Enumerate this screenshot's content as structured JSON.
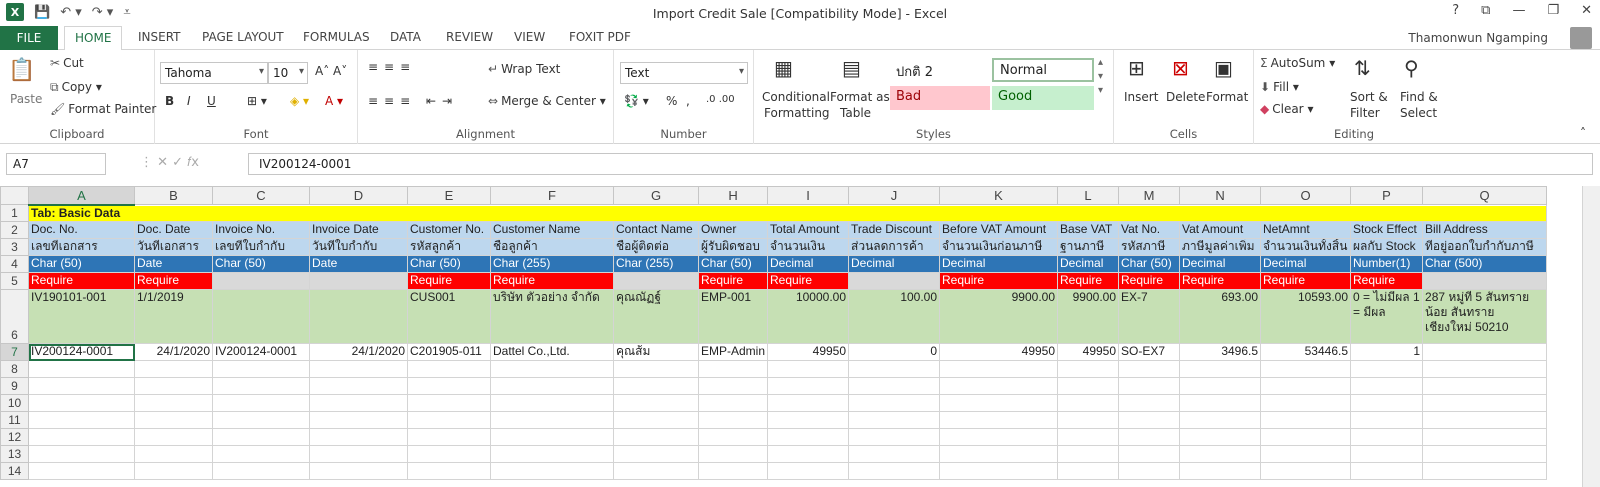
{
  "window": {
    "title": "Import Credit Sale  [Compatibility Mode] - Excel",
    "user": "Thamonwun Ngamping"
  },
  "tabs": [
    "FILE",
    "HOME",
    "INSERT",
    "PAGE LAYOUT",
    "FORMULAS",
    "DATA",
    "REVIEW",
    "VIEW",
    "FOXIT PDF"
  ],
  "ribbon": {
    "clipboard": {
      "paste": "Paste",
      "cut": "Cut",
      "copy": "Copy",
      "format_painter": "Format Painter",
      "label": "Clipboard"
    },
    "font": {
      "name": "Tahoma",
      "size": "10",
      "label": "Font",
      "bold": "B",
      "italic": "I",
      "underline": "U"
    },
    "alignment": {
      "wrap": "Wrap Text",
      "merge": "Merge & Center",
      "label": "Alignment"
    },
    "number": {
      "format": "Text",
      "label": "Number",
      "percent": "%",
      "comma": ","
    },
    "styles": {
      "conditional": "Conditional",
      "conditional2": "Formatting",
      "format_as": "Format as",
      "format_as2": "Table",
      "s1": "ปกติ 2",
      "s2": "Normal",
      "s3": "Bad",
      "s4": "Good",
      "label": "Styles"
    },
    "cells": {
      "insert": "Insert",
      "delete": "Delete",
      "format": "Format",
      "label": "Cells"
    },
    "editing": {
      "autosum": "AutoSum",
      "fill": "Fill",
      "clear": "Clear",
      "sort": "Sort &",
      "sort2": "Filter",
      "find": "Find &",
      "find2": "Select",
      "label": "Editing"
    }
  },
  "formula_bar": {
    "name_box": "A7",
    "formula": "IV200124-0001"
  },
  "columns": [
    "A",
    "B",
    "C",
    "D",
    "E",
    "F",
    "G",
    "H",
    "I",
    "J",
    "K",
    "L",
    "M",
    "N",
    "O",
    "P",
    "Q"
  ],
  "rows": {
    "r1": [
      "Tab: Basic Data"
    ],
    "r2": [
      "Doc. No.",
      "Doc. Date",
      "Invoice No.",
      "Invoice Date",
      "Customer No.",
      "Customer Name",
      "Contact Name",
      "Owner",
      "Total Amount",
      "Trade Discount",
      "Before VAT Amount",
      "Base VAT",
      "Vat No.",
      "Vat Amount",
      "NetAmnt",
      "Stock Effect",
      "Bill Address"
    ],
    "r3": [
      "เลขที่เอกสาร",
      "วันที่เอกสาร",
      "เลขที่ใบกำกับ",
      "วันที่ใบกำกับ",
      "รหัสลูกค้า",
      "ชื่อลูกค้า",
      "ชื่อผู้ติดต่อ",
      "ผู้รับผิดชอบ",
      "จำนวนเงิน",
      "ส่วนลดการค้า",
      "จำนวนเงินก่อนภาษี",
      "ฐานภาษี",
      "รหัสภาษี",
      "ภาษีมูลค่าเพิ่ม",
      "จำนวนเงินทั้งสิ้น",
      "ผลกับ Stock",
      "ที่อยู่ออกใบกำกับภาษี"
    ],
    "r4": [
      "Char (50)",
      "Date",
      "Char (50)",
      "Date",
      "Char (50)",
      "Char (255)",
      "Char (255)",
      "Char (50)",
      "Decimal",
      "Decimal",
      "Decimal",
      "Decimal",
      "Char (50)",
      "Decimal",
      "Decimal",
      "Number(1)",
      "Char (500)"
    ],
    "r5": [
      "Require",
      "Require",
      "",
      "",
      "Require",
      "Require",
      "",
      "Require",
      "Require",
      "",
      "Require",
      "Require",
      "Require",
      "Require",
      "Require",
      "Require",
      ""
    ],
    "r6": [
      "IV190101-001",
      "1/1/2019",
      "",
      "",
      "CUS001",
      "บริษัท ตัวอย่าง จำกัด",
      "คุณณัฏฐ์",
      "EMP-001",
      "10000.00",
      "100.00",
      "9900.00",
      "9900.00",
      "EX-7",
      "693.00",
      "10593.00",
      "0 = ไม่มีผล 1 = มีผล",
      "287 หมู่ที่ 5 สันทรายน้อย สันทราย เชียงใหม่ 50210"
    ],
    "r7": [
      "IV200124-0001",
      "24/1/2020",
      "IV200124-0001",
      "24/1/2020",
      "C201905-011",
      "Dattel Co.,Ltd.",
      "คุณส้ม",
      "EMP-Admin",
      "49950",
      "0",
      "49950",
      "49950",
      "SO-EX7",
      "3496.5",
      "53446.5",
      "1",
      ""
    ]
  },
  "row_numbers": [
    "1",
    "2",
    "3",
    "4",
    "5",
    "6",
    "7",
    "8",
    "9",
    "10",
    "11",
    "12",
    "13",
    "14"
  ]
}
